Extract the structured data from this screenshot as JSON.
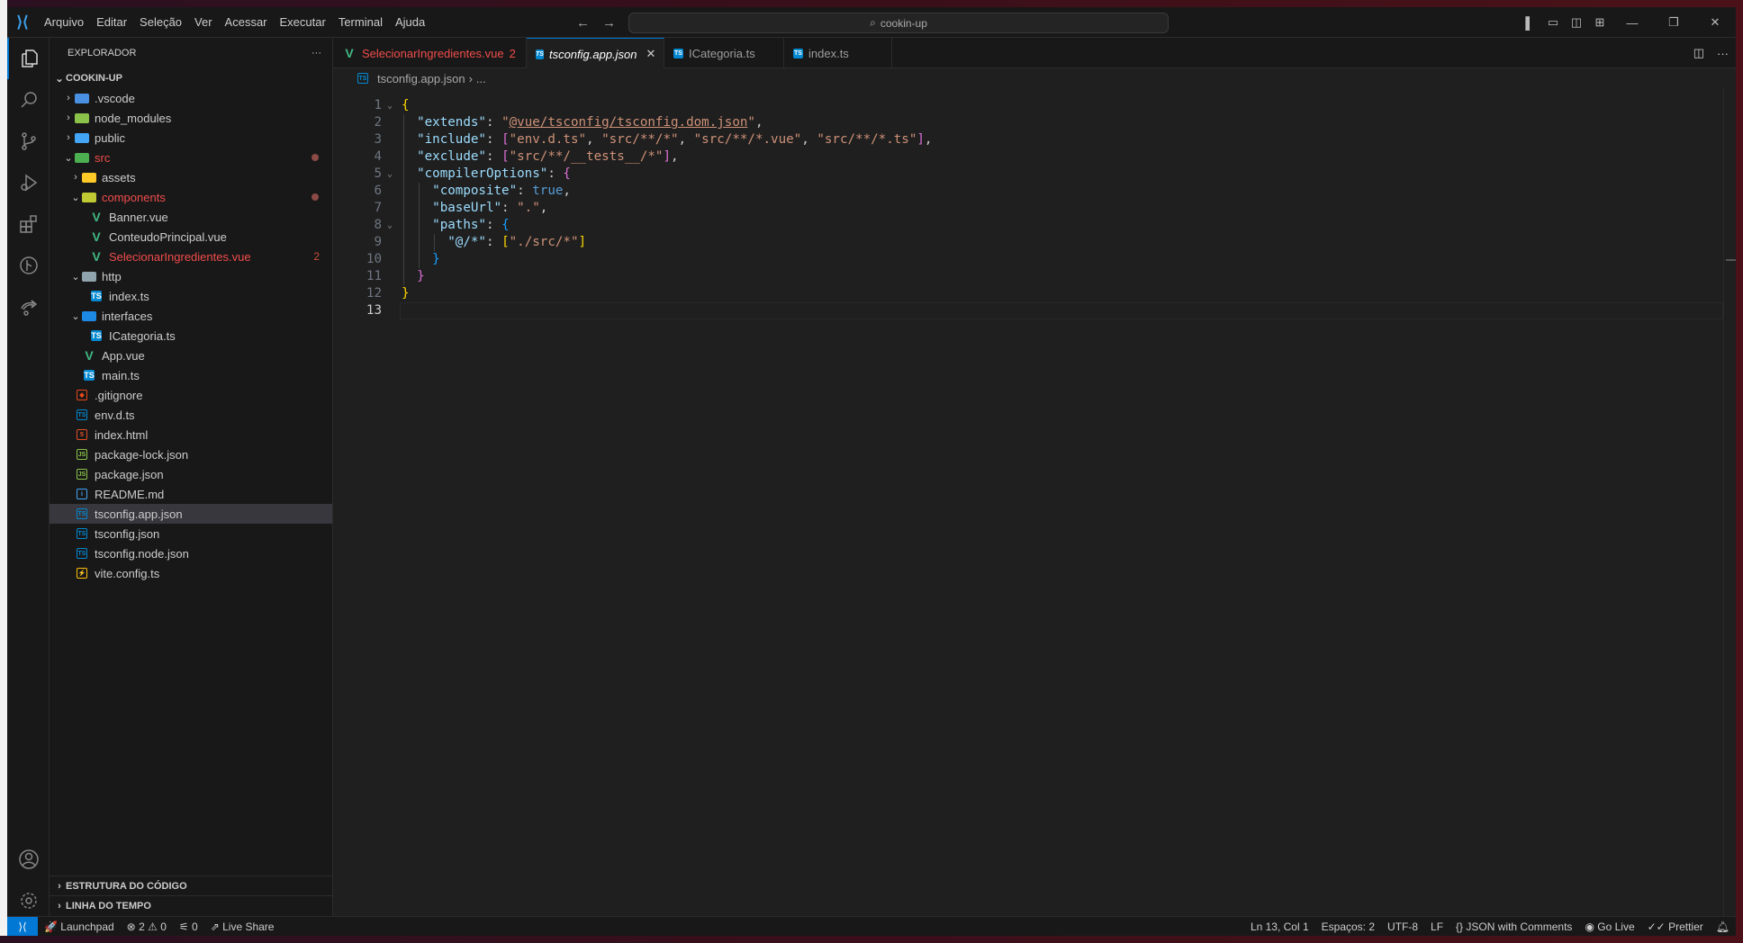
{
  "menu": [
    "Arquivo",
    "Editar",
    "Seleção",
    "Ver",
    "Acessar",
    "Executar",
    "Terminal",
    "Ajuda"
  ],
  "search": {
    "value": "cookin-up"
  },
  "sidebar": {
    "title": "EXPLORADOR",
    "more": "···",
    "root": "COOKIN-UP",
    "items": [
      {
        "label": ".vscode",
        "depth": 0,
        "chev": "closed",
        "icon": "folder-vscode",
        "color": "#4a90e2"
      },
      {
        "label": "node_modules",
        "depth": 0,
        "chev": "closed",
        "icon": "folder-node",
        "color": "#8bc34a"
      },
      {
        "label": "public",
        "depth": 0,
        "chev": "closed",
        "icon": "folder-public",
        "color": "#42a5f5"
      },
      {
        "label": "src",
        "depth": 0,
        "chev": "open",
        "icon": "folder-src",
        "color": "#4caf50",
        "modified": true,
        "dot": true
      },
      {
        "label": "assets",
        "depth": 1,
        "chev": "closed",
        "icon": "folder-assets",
        "color": "#ffca28"
      },
      {
        "label": "components",
        "depth": 1,
        "chev": "open",
        "icon": "folder-components",
        "color": "#c0ca33",
        "modified": true,
        "dot": true
      },
      {
        "label": "Banner.vue",
        "depth": 2,
        "icon": "vue",
        "color": "#41b883"
      },
      {
        "label": "ConteudoPrincipal.vue",
        "depth": 2,
        "icon": "vue",
        "color": "#41b883"
      },
      {
        "label": "SelecionarIngredientes.vue",
        "depth": 2,
        "icon": "vue",
        "color": "#41b883",
        "modified": true,
        "count": "2"
      },
      {
        "label": "http",
        "depth": 1,
        "chev": "open",
        "icon": "folder-open",
        "color": "#90a4ae"
      },
      {
        "label": "index.ts",
        "depth": 2,
        "icon": "ts",
        "color": "#0288d1"
      },
      {
        "label": "interfaces",
        "depth": 1,
        "chev": "open",
        "icon": "folder-interfaces",
        "color": "#1e88e5"
      },
      {
        "label": "ICategoria.ts",
        "depth": 2,
        "icon": "ts",
        "color": "#0288d1"
      },
      {
        "label": "App.vue",
        "depth": 1,
        "icon": "vue",
        "color": "#41b883"
      },
      {
        "label": "main.ts",
        "depth": 1,
        "icon": "ts",
        "color": "#0288d1"
      },
      {
        "label": ".gitignore",
        "depth": 0,
        "icon": "git",
        "color": "#e64a19"
      },
      {
        "label": "env.d.ts",
        "depth": 0,
        "icon": "ts-def",
        "color": "#0288d1"
      },
      {
        "label": "index.html",
        "depth": 0,
        "icon": "html",
        "color": "#e44d26"
      },
      {
        "label": "package-lock.json",
        "depth": 0,
        "icon": "nodejs",
        "color": "#8bc34a"
      },
      {
        "label": "package.json",
        "depth": 0,
        "icon": "nodejs",
        "color": "#8bc34a"
      },
      {
        "label": "README.md",
        "depth": 0,
        "icon": "info",
        "color": "#42a5f5"
      },
      {
        "label": "tsconfig.app.json",
        "depth": 0,
        "icon": "tsconfig",
        "color": "#0288d1",
        "selected": true
      },
      {
        "label": "tsconfig.json",
        "depth": 0,
        "icon": "tsconfig",
        "color": "#0288d1"
      },
      {
        "label": "tsconfig.node.json",
        "depth": 0,
        "icon": "tsconfig",
        "color": "#0288d1"
      },
      {
        "label": "vite.config.ts",
        "depth": 0,
        "icon": "vite",
        "color": "#ffc107"
      }
    ],
    "sections": [
      "ESTRUTURA DO CÓDIGO",
      "LINHA DO TEMPO"
    ]
  },
  "tabs": [
    {
      "label": "SelecionarIngredientes.vue",
      "badge": "2",
      "icon": "vue",
      "error": true
    },
    {
      "label": "tsconfig.app.json",
      "icon": "tsconfig",
      "active": true,
      "close": "✕"
    },
    {
      "label": "ICategoria.ts",
      "icon": "ts"
    },
    {
      "label": "index.ts",
      "icon": "ts"
    }
  ],
  "breadcrumb": {
    "file": "tsconfig.app.json",
    "sep": "›",
    "more": "..."
  },
  "editor": {
    "current_line": 13,
    "lines": [
      [
        [
          "g",
          "{"
        ]
      ],
      [
        [
          "p",
          "  "
        ],
        [
          "k",
          "\"extends\""
        ],
        [
          "p",
          ": "
        ],
        [
          "s",
          "\""
        ],
        [
          "su",
          "@vue/tsconfig/tsconfig.dom.json"
        ],
        [
          "s",
          "\""
        ],
        [
          "p",
          ","
        ]
      ],
      [
        [
          "p",
          "  "
        ],
        [
          "k",
          "\"include\""
        ],
        [
          "p",
          ": "
        ],
        [
          "m",
          "["
        ],
        [
          "s",
          "\"env.d.ts\""
        ],
        [
          "p",
          ", "
        ],
        [
          "s",
          "\"src/**/*\""
        ],
        [
          "p",
          ", "
        ],
        [
          "s",
          "\"src/**/*.vue\""
        ],
        [
          "p",
          ", "
        ],
        [
          "s",
          "\"src/**/*.ts\""
        ],
        [
          "m",
          "]"
        ],
        [
          "p",
          ","
        ]
      ],
      [
        [
          "p",
          "  "
        ],
        [
          "k",
          "\"exclude\""
        ],
        [
          "p",
          ": "
        ],
        [
          "m",
          "["
        ],
        [
          "s",
          "\"src/**/__tests__/*\""
        ],
        [
          "m",
          "]"
        ],
        [
          "p",
          ","
        ]
      ],
      [
        [
          "p",
          "  "
        ],
        [
          "k",
          "\"compilerOptions\""
        ],
        [
          "p",
          ": "
        ],
        [
          "m",
          "{"
        ]
      ],
      [
        [
          "p",
          "    "
        ],
        [
          "k",
          "\"composite\""
        ],
        [
          "p",
          ": "
        ],
        [
          "b",
          "true"
        ],
        [
          "p",
          ","
        ]
      ],
      [
        [
          "p",
          "    "
        ],
        [
          "k",
          "\"baseUrl\""
        ],
        [
          "p",
          ": "
        ],
        [
          "s",
          "\".\""
        ],
        [
          "p",
          ","
        ]
      ],
      [
        [
          "p",
          "    "
        ],
        [
          "k",
          "\"paths\""
        ],
        [
          "p",
          ": "
        ],
        [
          "c",
          "{"
        ]
      ],
      [
        [
          "p",
          "      "
        ],
        [
          "k",
          "\"@/*\""
        ],
        [
          "p",
          ": "
        ],
        [
          "g",
          "["
        ],
        [
          "s",
          "\"./src/*\""
        ],
        [
          "g",
          "]"
        ]
      ],
      [
        [
          "p",
          "    "
        ],
        [
          "c",
          "}"
        ]
      ],
      [
        [
          "p",
          "  "
        ],
        [
          "m",
          "}"
        ]
      ],
      [
        [
          "g",
          "}"
        ]
      ],
      []
    ],
    "folds": [
      1,
      5,
      8
    ]
  },
  "status": {
    "remote_icon": "remote-icon",
    "launchpad": "Launchpad",
    "errors": "2",
    "warnings": "0",
    "ports": "0",
    "liveshare": "Live Share",
    "position": "Ln 13, Col 1",
    "spaces": "Espaços: 2",
    "encoding": "UTF-8",
    "eol": "LF",
    "language": "JSON with Comments",
    "golive": "Go Live",
    "prettier": "Prettier"
  },
  "colors": {
    "accent": "#0078d4",
    "error": "#f14c4c"
  }
}
